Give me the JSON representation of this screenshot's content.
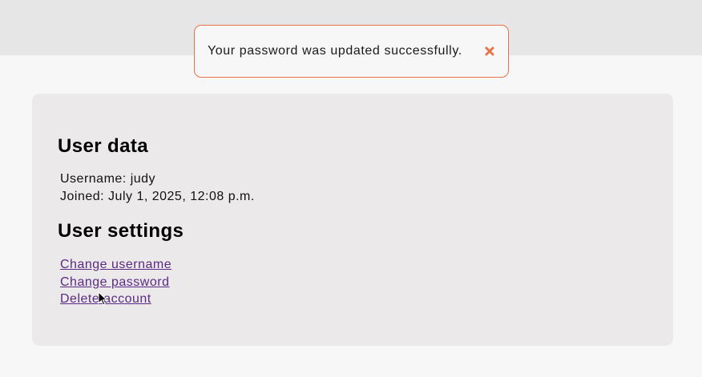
{
  "notification": {
    "message": "Your password was updated successfully.",
    "close_icon": "close-x-icon",
    "accent_color": "#e8734a"
  },
  "user_data": {
    "heading": "User data",
    "username_line": "Username: judy",
    "joined_line": "Joined: July 1, 2025, 12:08 p.m."
  },
  "user_settings": {
    "heading": "User settings",
    "links": {
      "change_username": "Change username",
      "change_password": "Change password",
      "delete_account": "Delete account"
    },
    "link_color": "#5b2a86"
  }
}
